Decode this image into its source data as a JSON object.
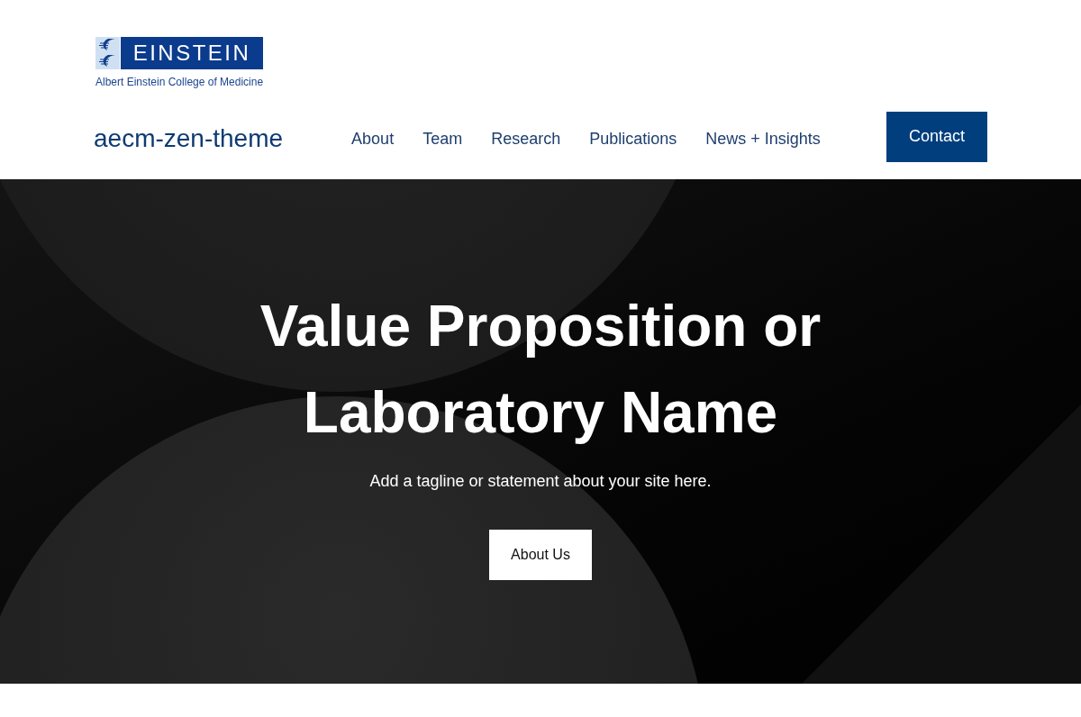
{
  "header": {
    "logo": {
      "wordmark": "EINSTEIN",
      "subtitle": "Albert Einstein College of Medicine"
    },
    "site_title": "aecm-zen-theme",
    "nav": [
      {
        "label": "About"
      },
      {
        "label": "Team"
      },
      {
        "label": "Research"
      },
      {
        "label": "Publications"
      },
      {
        "label": "News + Insights"
      }
    ],
    "contact_button": "Contact"
  },
  "hero": {
    "title": "Value Proposition or Laboratory Name",
    "tagline": "Add a tagline or statement about your site here.",
    "button": "About Us"
  }
}
